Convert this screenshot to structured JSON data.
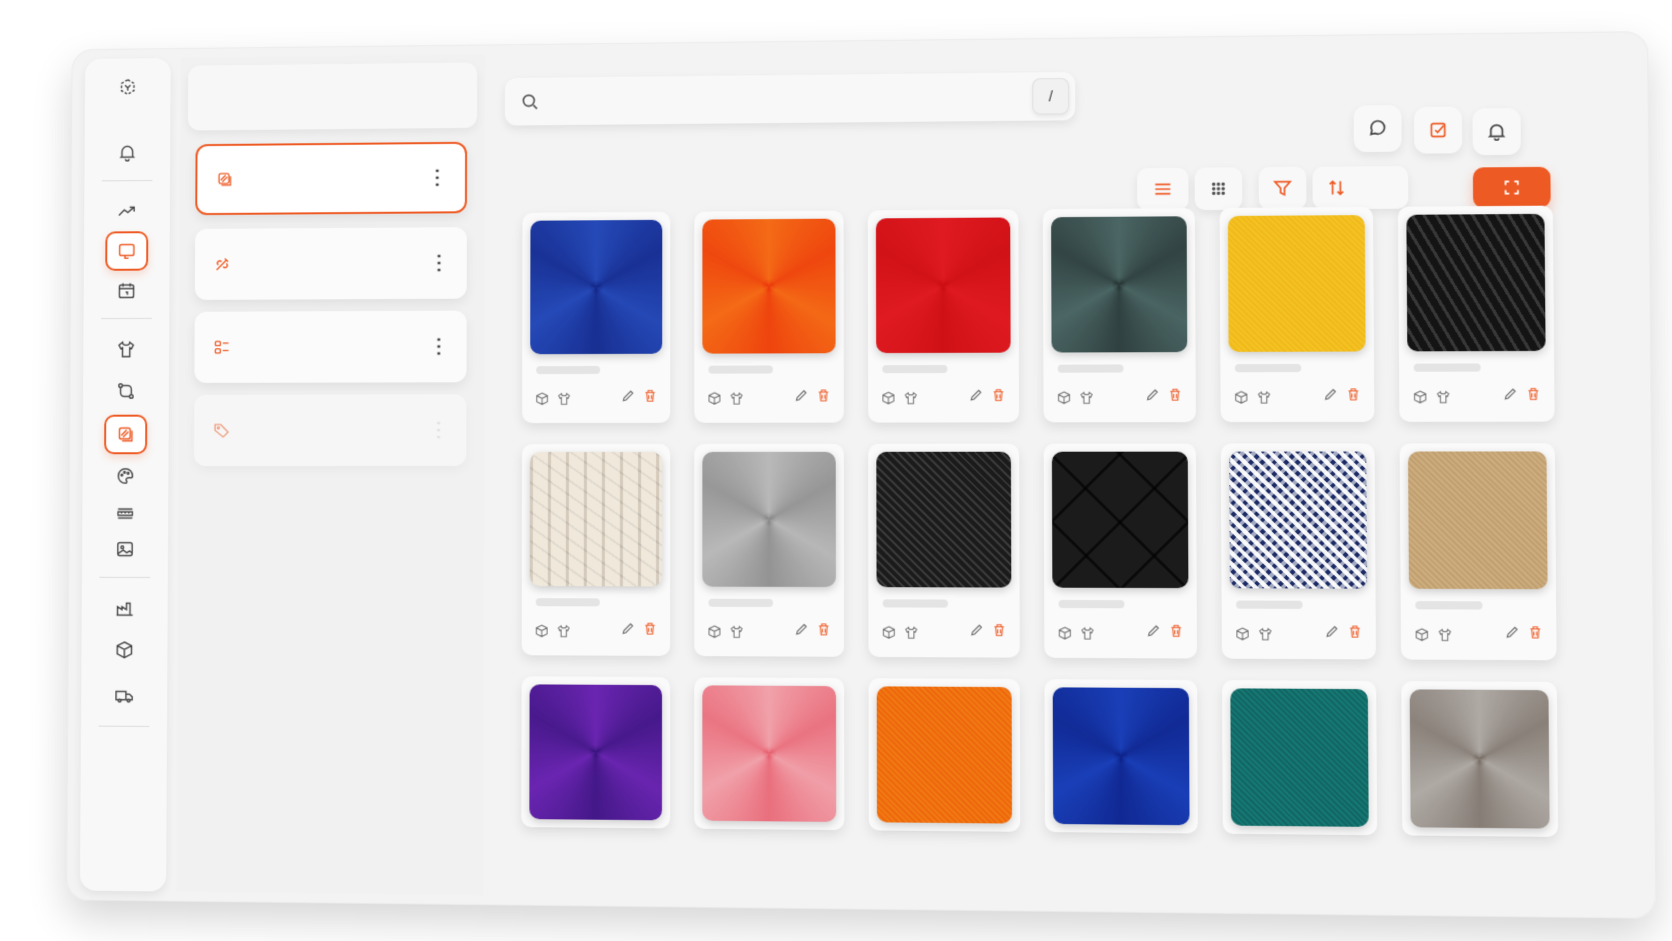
{
  "app": {
    "logo_icon": "cube-logo-icon",
    "accent_color": "#ee5a24"
  },
  "sidebar": {
    "items": [
      {
        "icon": "bell-icon",
        "active": false
      },
      {
        "icon": "trend-up-icon",
        "active": false
      },
      {
        "icon": "screen-icon",
        "active": true
      },
      {
        "icon": "calendar-icon",
        "active": false
      },
      {
        "icon": "tshirt-icon",
        "active": false
      },
      {
        "icon": "git-compare-icon",
        "active": false
      },
      {
        "icon": "fabric-layers-icon",
        "active": true
      },
      {
        "icon": "palette-icon",
        "active": false
      },
      {
        "icon": "ruler-icon",
        "active": false
      },
      {
        "icon": "image-icon",
        "active": false
      },
      {
        "icon": "factory-icon",
        "active": false
      },
      {
        "icon": "box-icon",
        "active": false
      },
      {
        "icon": "truck-icon",
        "active": false
      }
    ]
  },
  "collections": [
    {
      "icon": "fabric-layers-icon",
      "active": true
    },
    {
      "icon": "needle-thread-icon",
      "active": false
    },
    {
      "icon": "grid-list-icon",
      "active": false
    },
    {
      "icon": "tag-icon",
      "active": false,
      "faded": true
    }
  ],
  "search": {
    "placeholder": "",
    "value": "",
    "shortcut": "/"
  },
  "header_actions": [
    {
      "icon": "chat-icon"
    },
    {
      "icon": "checkbox-icon"
    },
    {
      "icon": "bell-icon"
    }
  ],
  "toolbar": {
    "view_list_icon": "list-view-icon",
    "view_grid_icon": "grid-view-icon",
    "filter_icon": "filter-icon",
    "sort_icon": "sort-icon",
    "primary_icon": "fullscreen-icon"
  },
  "materials": [
    {
      "color": "#1f3ea8",
      "texture": "swirl"
    },
    {
      "color": "#f25a12",
      "texture": "swirl"
    },
    {
      "color": "#d9161c",
      "texture": "swirl"
    },
    {
      "color": "#3f5655",
      "texture": "swirl"
    },
    {
      "color": "#f2be1e",
      "texture": "flat"
    },
    {
      "color": "#1d1d1d",
      "texture": "leather"
    },
    {
      "color": "#ece3d3",
      "texture": "knit"
    },
    {
      "color": "#a9a9a9",
      "texture": "swirl"
    },
    {
      "color": "#262626",
      "texture": "cord"
    },
    {
      "color": "#1b1b1b",
      "texture": "quilt"
    },
    {
      "color": "#1d2c66",
      "texture": "hound"
    },
    {
      "color": "#c7a677",
      "texture": "flat"
    },
    {
      "color": "#5a1fa0",
      "texture": "swirl"
    },
    {
      "color": "#ee8c97",
      "texture": "swirl"
    },
    {
      "color": "#f0700f",
      "texture": "flat"
    },
    {
      "color": "#1535a8",
      "texture": "swirl"
    },
    {
      "color": "#136f6b",
      "texture": "flat"
    },
    {
      "color": "#9e9791",
      "texture": "swirl"
    }
  ]
}
